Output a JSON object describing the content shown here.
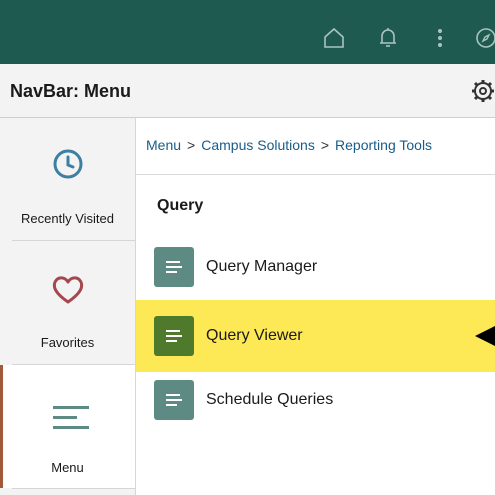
{
  "topbar": {
    "icons": [
      "home-icon",
      "bell-icon",
      "kebab-menu-icon",
      "navbar-compass-icon"
    ],
    "background": "#1f5a50"
  },
  "header": {
    "title": "NavBar: Menu",
    "settings_icon": "gear-icon"
  },
  "sidebar": {
    "items": [
      {
        "label": "Recently Visited",
        "icon": "clock-icon"
      },
      {
        "label": "Favorites",
        "icon": "heart-icon"
      },
      {
        "label": "Menu",
        "icon": "menu-lines-icon",
        "active": true
      }
    ]
  },
  "breadcrumb": {
    "items": [
      "Menu",
      "Campus Solutions",
      "Reporting Tools"
    ],
    "separator": ">"
  },
  "section": {
    "title": "Query",
    "items": [
      {
        "label": "Query Manager",
        "icon": "document-icon"
      },
      {
        "label": "Query Viewer",
        "icon": "document-icon",
        "highlighted": true
      },
      {
        "label": "Schedule Queries",
        "icon": "document-icon"
      }
    ]
  },
  "colors": {
    "highlight": "#fde955",
    "doc_icon": "#5e8a84",
    "doc_icon_active": "#4f7a2b",
    "link": "#1a5c8a",
    "accent": "#a05a3a"
  }
}
